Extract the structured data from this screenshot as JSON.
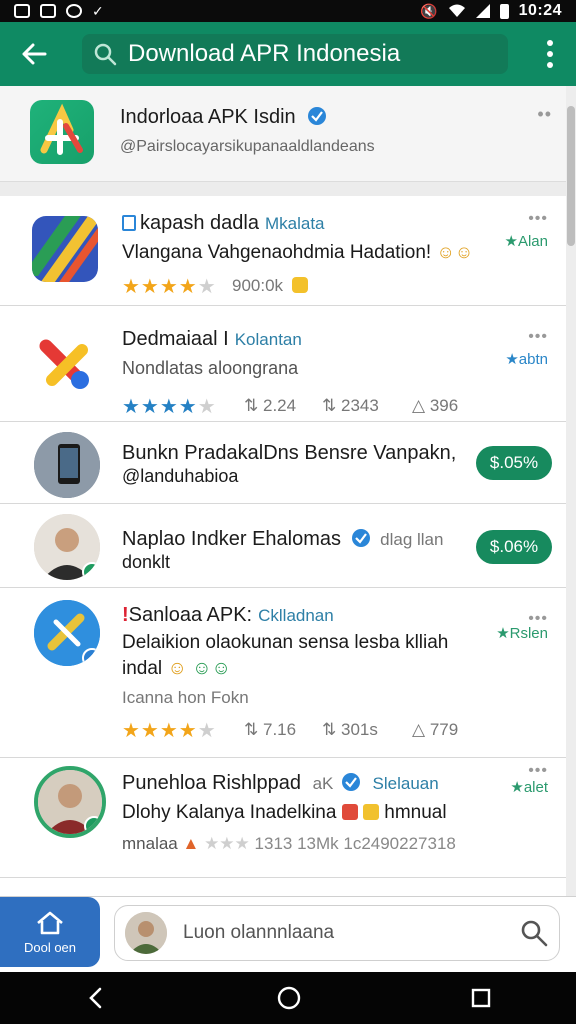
{
  "status_bar": {
    "time": "10:24",
    "icons": [
      "image-icon",
      "square-icon",
      "ring-icon",
      "chevron-icon"
    ],
    "right_icons": [
      "mute-icon",
      "wifi-icon",
      "signal-icon",
      "battery-icon"
    ]
  },
  "app_bar": {
    "search_text": "Download APR Indonesia",
    "accent": "#0f8a63"
  },
  "pinned": {
    "title": "Indorloaa APK Isdin",
    "subtitle": "@Pairslocayarsikupanaaldlandeans"
  },
  "items": [
    {
      "title": "kapash dadla",
      "dev": "Mkalata",
      "desc": "Vlangana Vahgenaohdmia Hadation!",
      "tag": "Alan",
      "rating": "900:0k"
    },
    {
      "title": "Dedmaiaal I",
      "dev": "Kolantan",
      "desc": "Nondlatas aloongrana",
      "tag": "abtn",
      "stat1": "2.24",
      "stat2": "2343",
      "stat3": "396"
    },
    {
      "title": "Bunkn PradakalDns Bensre Vanpakn,",
      "desc": "@landuhabioa",
      "price": "$.05%"
    },
    {
      "title": "Naplao Indker Ehalomas",
      "dev": "dlag llan",
      "desc": "donklt",
      "price": "$.06%"
    },
    {
      "title": "Sanloaa APK:",
      "dev": "Cklladnan",
      "desc": "Delaikion olaokunan sensa lesba klliah",
      "desc2": "indal",
      "sub": "Icanna hon Fokn",
      "tag": "Rslen",
      "stat1": "7.16",
      "stat2": "301s",
      "stat3": "779"
    },
    {
      "title": "Punehloa Rishlppad",
      "dev2": "aK",
      "dev": "Slelauan",
      "desc": "Dlohy Kalanya Inadelkina",
      "desc_tail": "hmnual",
      "tag": "alet",
      "meta_text": "mnalaa",
      "meta_nums": "1313 13Mk 1c2490227318"
    }
  ],
  "bottom": {
    "home_label": "Dool oen",
    "compose_placeholder": "Luon olannnlaana"
  }
}
